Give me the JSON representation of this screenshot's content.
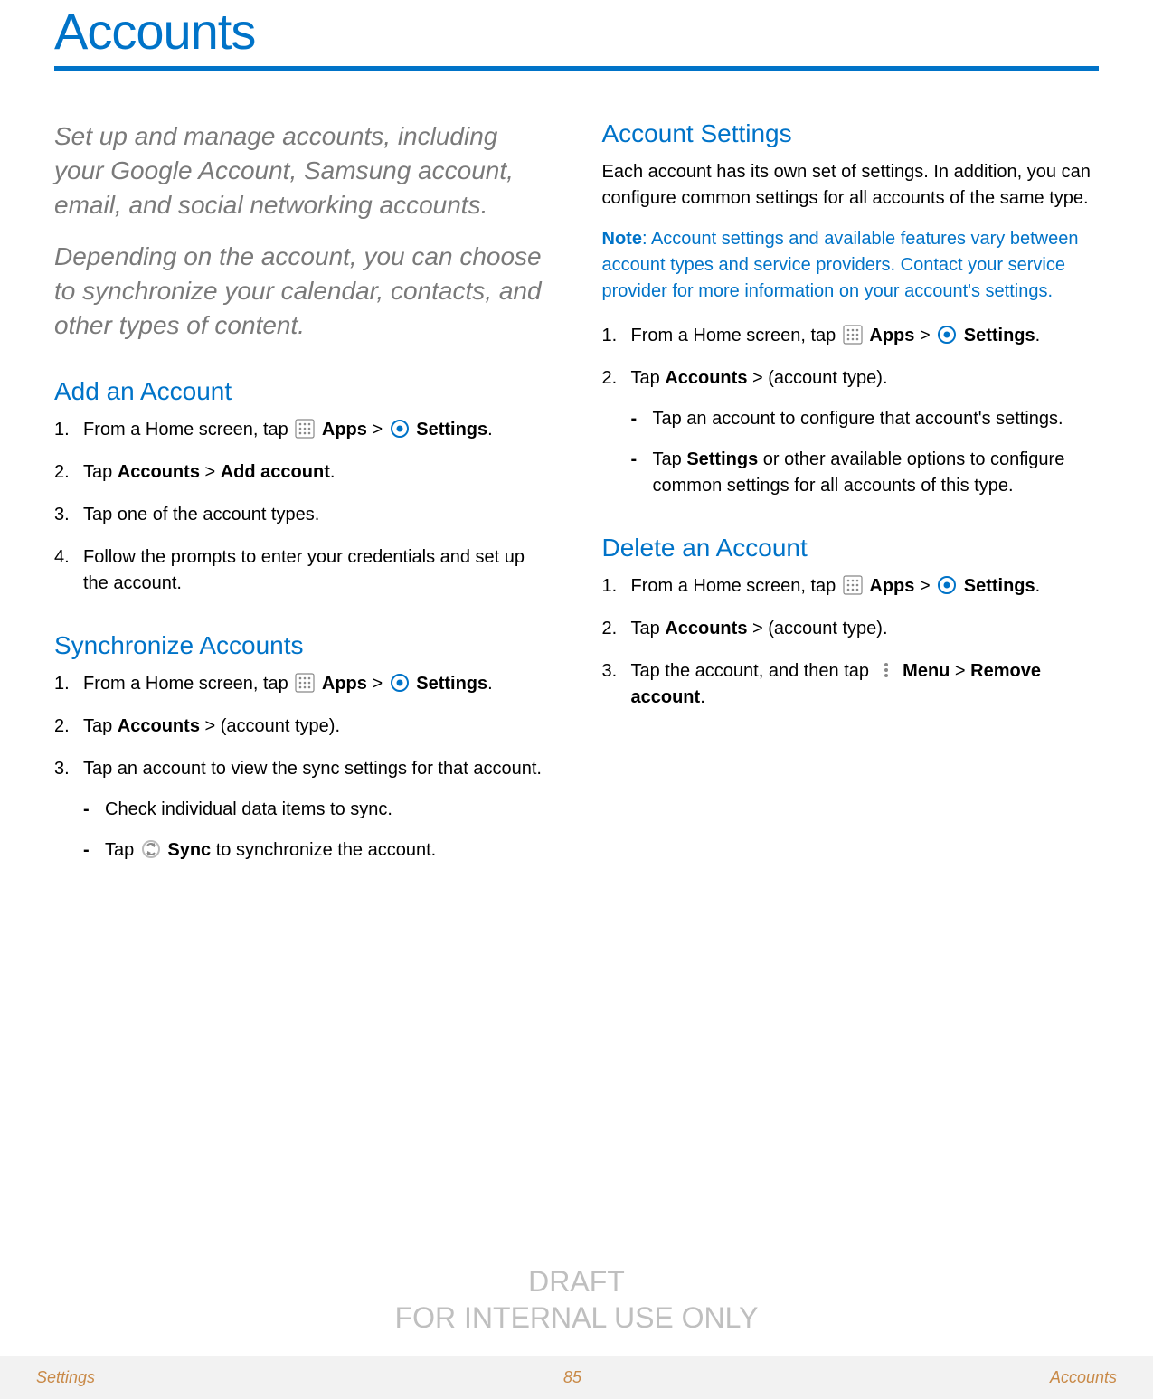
{
  "title": "Accounts",
  "intro": {
    "p1": "Set up and manage accounts, including your Google Account, Samsung account, email, and social networking accounts.",
    "p2": "Depending on the account, you can choose to synchronize your calendar, contacts, and other types of content."
  },
  "icons": {
    "apps": "Apps",
    "settings": "Settings",
    "sync": "Sync",
    "menu": "Menu"
  },
  "left": {
    "add": {
      "heading": "Add an Account",
      "steps": {
        "s1a": "From a Home screen, tap ",
        "s1b": "Apps",
        "s1c": " > ",
        "s1d": "Settings",
        "s1e": ".",
        "s2a": "Tap ",
        "s2b": "Accounts",
        "s2c": " > ",
        "s2d": "Add account",
        "s2e": ".",
        "s3": "Tap one of the account types.",
        "s4": "Follow the prompts to enter your credentials and set up the account."
      }
    },
    "sync": {
      "heading": "Synchronize Accounts",
      "steps": {
        "s1a": "From a Home screen, tap ",
        "s1b": "Apps",
        "s1c": " > ",
        "s1d": "Settings",
        "s1e": ".",
        "s2a": "Tap ",
        "s2b": "Accounts",
        "s2c": " > (account type).",
        "s3": "Tap an account to view the sync settings for that account.",
        "sub1": "Check individual data items to sync.",
        "sub2a": "Tap ",
        "sub2b": "Sync",
        "sub2c": " to synchronize the account."
      }
    }
  },
  "right": {
    "settings": {
      "heading": "Account Settings",
      "p1": "Each account has its own set of settings. In addition, you can configure common settings for all accounts of the same type.",
      "note_label": "Note",
      "note_text": ": Account settings and available features vary between account types and service providers. Contact your service provider for more information on your account's settings.",
      "steps": {
        "s1a": "From a Home screen, tap ",
        "s1b": "Apps",
        "s1c": " > ",
        "s1d": "Settings",
        "s1e": ".",
        "s2a": "Tap ",
        "s2b": "Accounts",
        "s2c": " > (account type).",
        "sub1": "Tap an account to configure that account's settings.",
        "sub2a": "Tap ",
        "sub2b": "Settings",
        "sub2c": " or other available options to configure common settings for all accounts of this type."
      }
    },
    "delete": {
      "heading": "Delete an Account",
      "steps": {
        "s1a": "From a Home screen, tap ",
        "s1b": "Apps",
        "s1c": " > ",
        "s1d": "Settings",
        "s1e": ".",
        "s2a": "Tap ",
        "s2b": "Accounts",
        "s2c": " > (account type).",
        "s3a": "Tap the account, and then tap ",
        "s3b": "Menu",
        "s3c": " > ",
        "s3d": "Remove account",
        "s3e": "."
      }
    }
  },
  "watermark": {
    "l1": "DRAFT",
    "l2": "FOR INTERNAL USE ONLY"
  },
  "footer": {
    "left": "Settings",
    "center": "85",
    "right": "Accounts"
  }
}
